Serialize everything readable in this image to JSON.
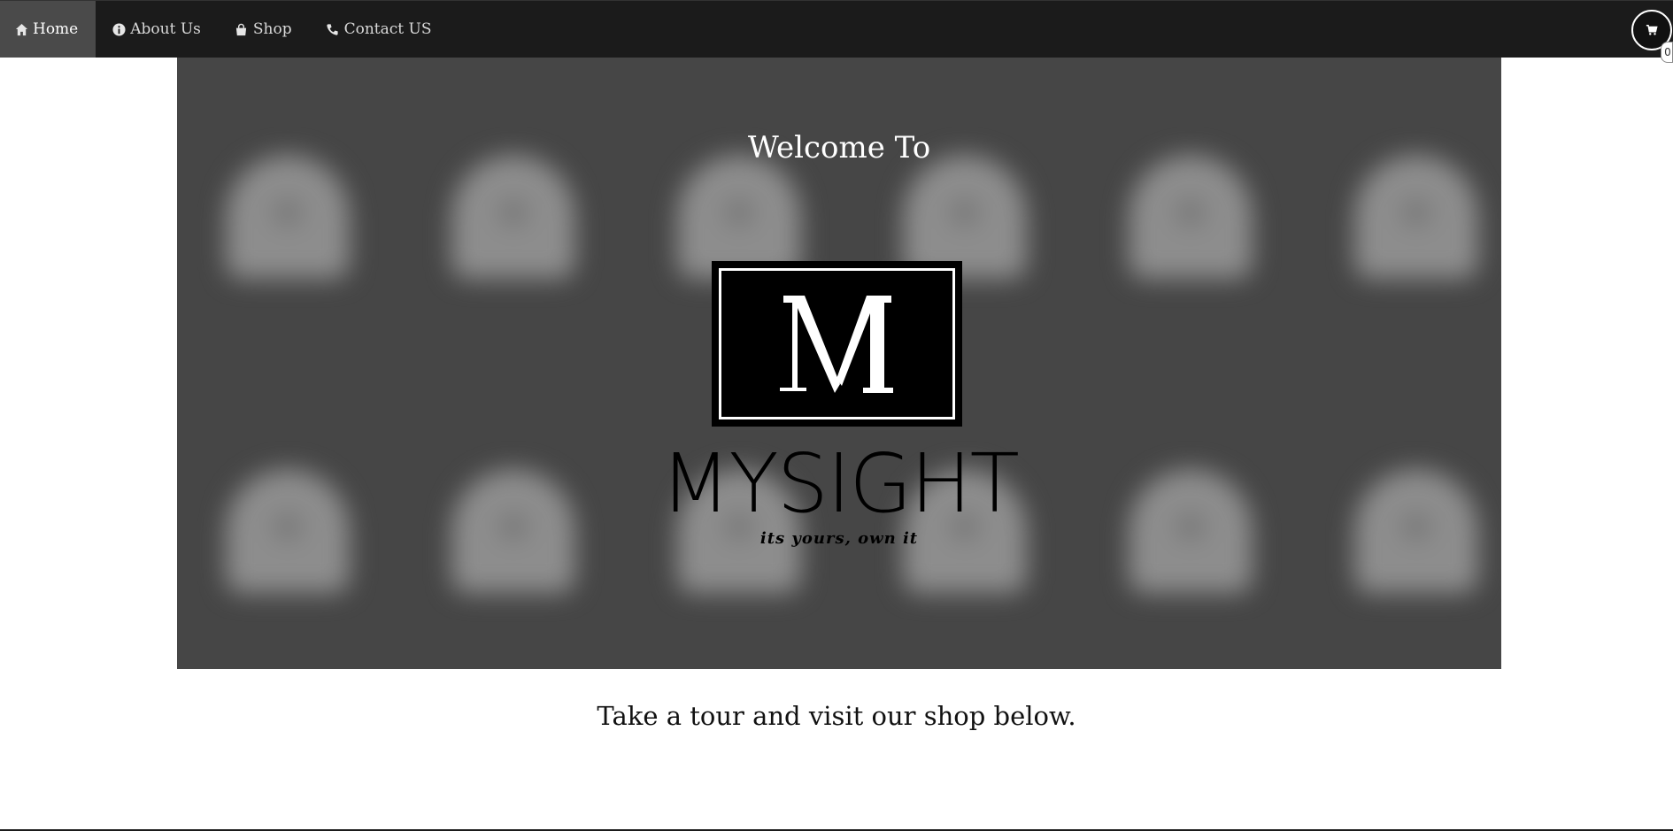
{
  "nav": {
    "items": [
      {
        "label": "Home",
        "icon": "home-icon",
        "active": true
      },
      {
        "label": "About Us",
        "icon": "info-icon",
        "active": false
      },
      {
        "label": "Shop",
        "icon": "shopping-bag-icon",
        "active": false
      },
      {
        "label": "Contact US",
        "icon": "phone-icon",
        "active": false
      }
    ],
    "cart": {
      "icon": "cart-icon",
      "count": "0"
    }
  },
  "hero": {
    "welcome": "Welcome To",
    "logo_letter": "M",
    "brand_name": "MYSIGHT",
    "tagline": "its yours, own it"
  },
  "tour_text": "Take a tour and visit our shop below.",
  "colors": {
    "navbar": "#1b1b1b",
    "nav_active": "#4a4a4a",
    "hero_bg": "#464646"
  }
}
